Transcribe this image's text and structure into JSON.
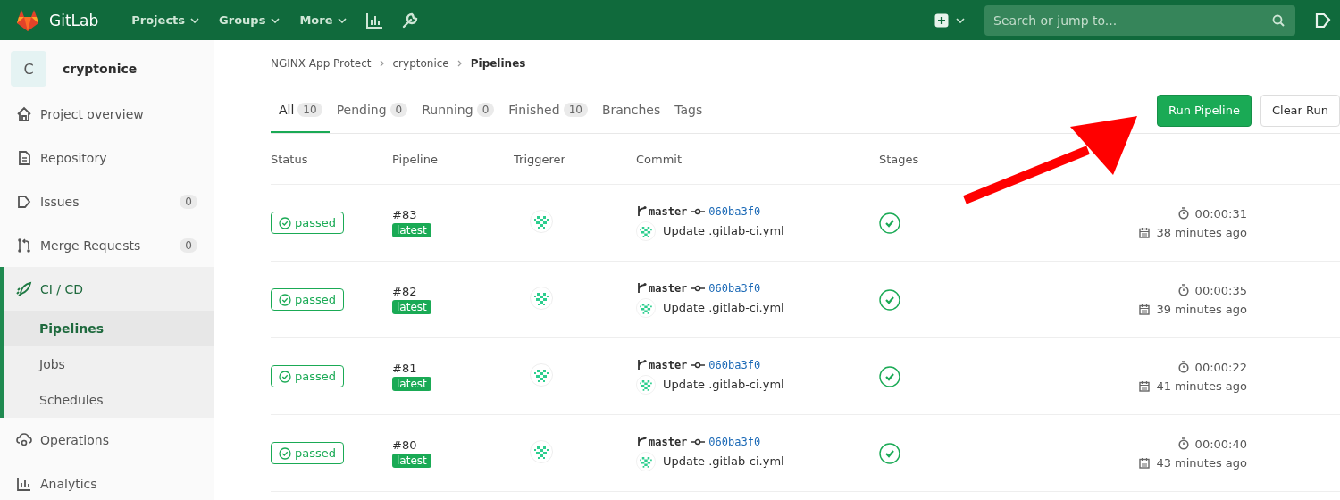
{
  "topbar": {
    "brand": "GitLab",
    "menus": [
      {
        "label": "Projects"
      },
      {
        "label": "Groups"
      },
      {
        "label": "More"
      }
    ],
    "search": {
      "placeholder": "Search or jump to..."
    }
  },
  "sidebar": {
    "project": {
      "avatar": "C",
      "name": "cryptonice"
    },
    "items": [
      {
        "label": "Project overview",
        "selected": false
      },
      {
        "label": "Repository",
        "selected": false
      },
      {
        "label": "Issues",
        "count": "0",
        "selected": false
      },
      {
        "label": "Merge Requests",
        "count": "0",
        "selected": false
      },
      {
        "label": "CI / CD",
        "selected": true,
        "children": [
          {
            "label": "Pipelines",
            "selected": true
          },
          {
            "label": "Jobs",
            "selected": false
          },
          {
            "label": "Schedules",
            "selected": false
          }
        ]
      },
      {
        "label": "Operations",
        "selected": false
      },
      {
        "label": "Analytics",
        "selected": false
      }
    ]
  },
  "breadcrumbs": [
    "NGINX App Protect",
    "cryptonice",
    "Pipelines"
  ],
  "tabs": [
    {
      "label": "All",
      "count": "10",
      "selected": true
    },
    {
      "label": "Pending",
      "count": "0",
      "selected": false
    },
    {
      "label": "Running",
      "count": "0",
      "selected": false
    },
    {
      "label": "Finished",
      "count": "10",
      "selected": false
    },
    {
      "label": "Branches",
      "selected": false
    },
    {
      "label": "Tags",
      "selected": false
    }
  ],
  "actions": [
    {
      "label": "Run Pipeline",
      "kind": "primary"
    },
    {
      "label": "Clear Run",
      "kind": "secondary"
    }
  ],
  "table": {
    "columns": [
      "Status",
      "Pipeline",
      "Triggerer",
      "Commit",
      "Stages"
    ],
    "rows": [
      {
        "status": "passed",
        "pipeline": "#83",
        "tag": "latest",
        "branch": "master",
        "sha": "060ba3f0",
        "message": "Update .gitlab-ci.yml",
        "duration": "00:00:31",
        "finished": "38 minutes ago"
      },
      {
        "status": "passed",
        "pipeline": "#82",
        "tag": "latest",
        "branch": "master",
        "sha": "060ba3f0",
        "message": "Update .gitlab-ci.yml",
        "duration": "00:00:35",
        "finished": "39 minutes ago"
      },
      {
        "status": "passed",
        "pipeline": "#81",
        "tag": "latest",
        "branch": "master",
        "sha": "060ba3f0",
        "message": "Update .gitlab-ci.yml",
        "duration": "00:00:22",
        "finished": "41 minutes ago"
      },
      {
        "status": "passed",
        "pipeline": "#80",
        "tag": "latest",
        "branch": "master",
        "sha": "060ba3f0",
        "message": "Update .gitlab-ci.yml",
        "duration": "00:00:40",
        "finished": "43 minutes ago"
      }
    ]
  }
}
